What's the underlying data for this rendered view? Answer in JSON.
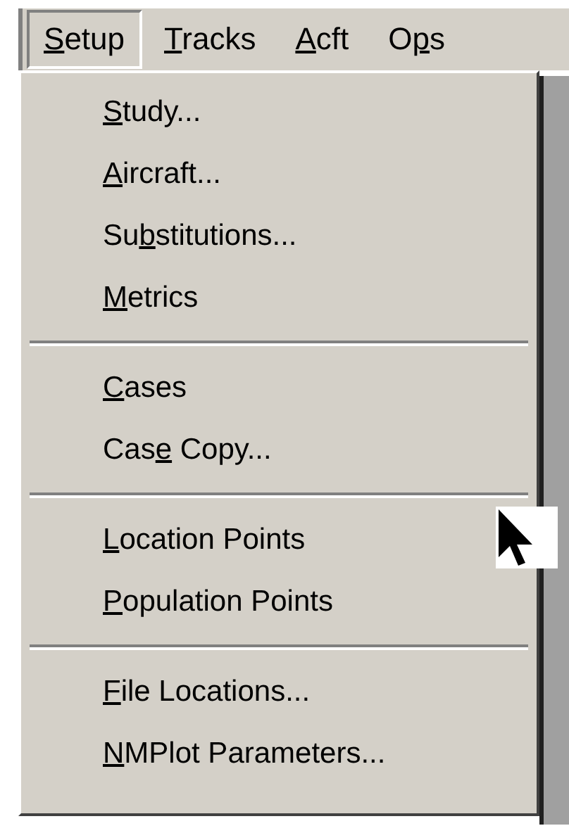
{
  "menubar": [
    {
      "key": "S",
      "post": "etup",
      "selected": true
    },
    {
      "key": "T",
      "post": "racks",
      "selected": false
    },
    {
      "key": "A",
      "post": "cft",
      "selected": false
    },
    {
      "pre": "O",
      "key": "p",
      "post": "s",
      "selected": false
    }
  ],
  "menu": [
    {
      "kind": "item",
      "key": "S",
      "post": "tudy..."
    },
    {
      "kind": "item",
      "key": "A",
      "post": "ircraft..."
    },
    {
      "kind": "item",
      "pre": "Su",
      "key": "b",
      "post": "stitutions..."
    },
    {
      "kind": "item",
      "key": "M",
      "post": "etrics"
    },
    {
      "kind": "separator"
    },
    {
      "kind": "item",
      "key": "C",
      "post": "ases"
    },
    {
      "kind": "item",
      "pre": "Cas",
      "key": "e",
      "post": " Copy..."
    },
    {
      "kind": "separator"
    },
    {
      "kind": "item",
      "key": "L",
      "post": "ocation Points"
    },
    {
      "kind": "item",
      "key": "P",
      "post": "opulation Points"
    },
    {
      "kind": "separator"
    },
    {
      "kind": "item",
      "key": "F",
      "post": "ile Locations..."
    },
    {
      "kind": "item",
      "key": "N",
      "post": "MPlot Parameters..."
    }
  ]
}
